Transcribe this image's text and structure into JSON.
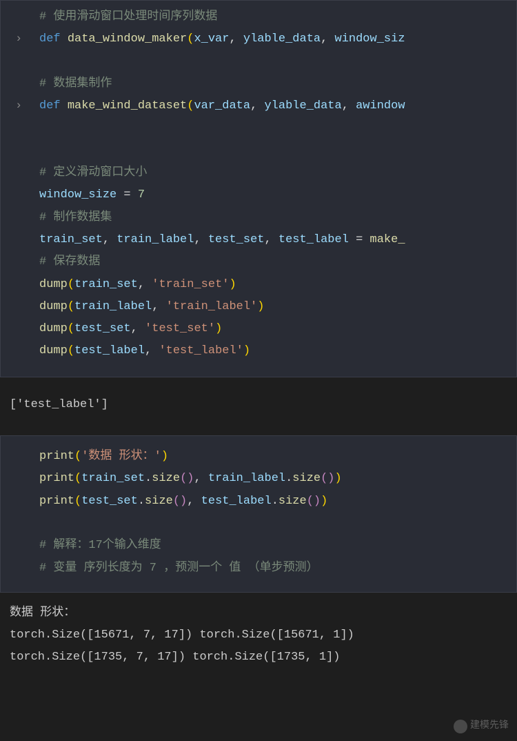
{
  "block1": {
    "comment1": "#  使用滑动窗口处理时间序列数据",
    "def1_keyword": "def",
    "def1_name": "data_window_maker",
    "def1_arg1": "x_var",
    "def1_arg2": "ylable_data",
    "def1_arg3": "window_siz",
    "comment2": "# 数据集制作",
    "def2_keyword": "def",
    "def2_name": "make_wind_dataset",
    "def2_arg1": "var_data",
    "def2_arg2": "ylable_data",
    "def2_arg3": "awindow",
    "comment3": "#  定义滑动窗口大小",
    "var_assign": "window_size",
    "var_equals": " = ",
    "var_value": "7",
    "comment4": "#  制作数据集",
    "train_vars": "train_set",
    "train_label": "train_label",
    "test_set": "test_set",
    "test_label": "test_label",
    "make_call": "make_",
    "comment5": "#  保存数据",
    "dump1_func": "dump",
    "dump1_arg1": "train_set",
    "dump1_str": "'train_set'",
    "dump2_func": "dump",
    "dump2_arg1": "train_label",
    "dump2_str": "'train_label'",
    "dump3_func": "dump",
    "dump3_arg1": "test_set",
    "dump3_str": "'test_set'",
    "dump4_func": "dump",
    "dump4_arg1": "test_label",
    "dump4_str": "'test_label'"
  },
  "output1": "['test_label']",
  "block2": {
    "print1_func": "print",
    "print1_str": "'数据 形状：'",
    "print2_func": "print",
    "print2_arg1": "train_set",
    "print2_method": "size",
    "print2_arg2": "train_label",
    "print3_func": "print",
    "print3_arg1": "test_set",
    "print3_arg2": "test_label",
    "comment1": "#  解释：17个输入维度",
    "comment2": "#  变量 序列长度为 7 ，预测一个 值 （单步预测）"
  },
  "output2": {
    "line1": "数据 形状：",
    "line2": "torch.Size([15671, 7, 17]) torch.Size([15671, 1])",
    "line3": "torch.Size([1735, 7, 17]) torch.Size([1735, 1])"
  },
  "watermark": "建模先锋"
}
